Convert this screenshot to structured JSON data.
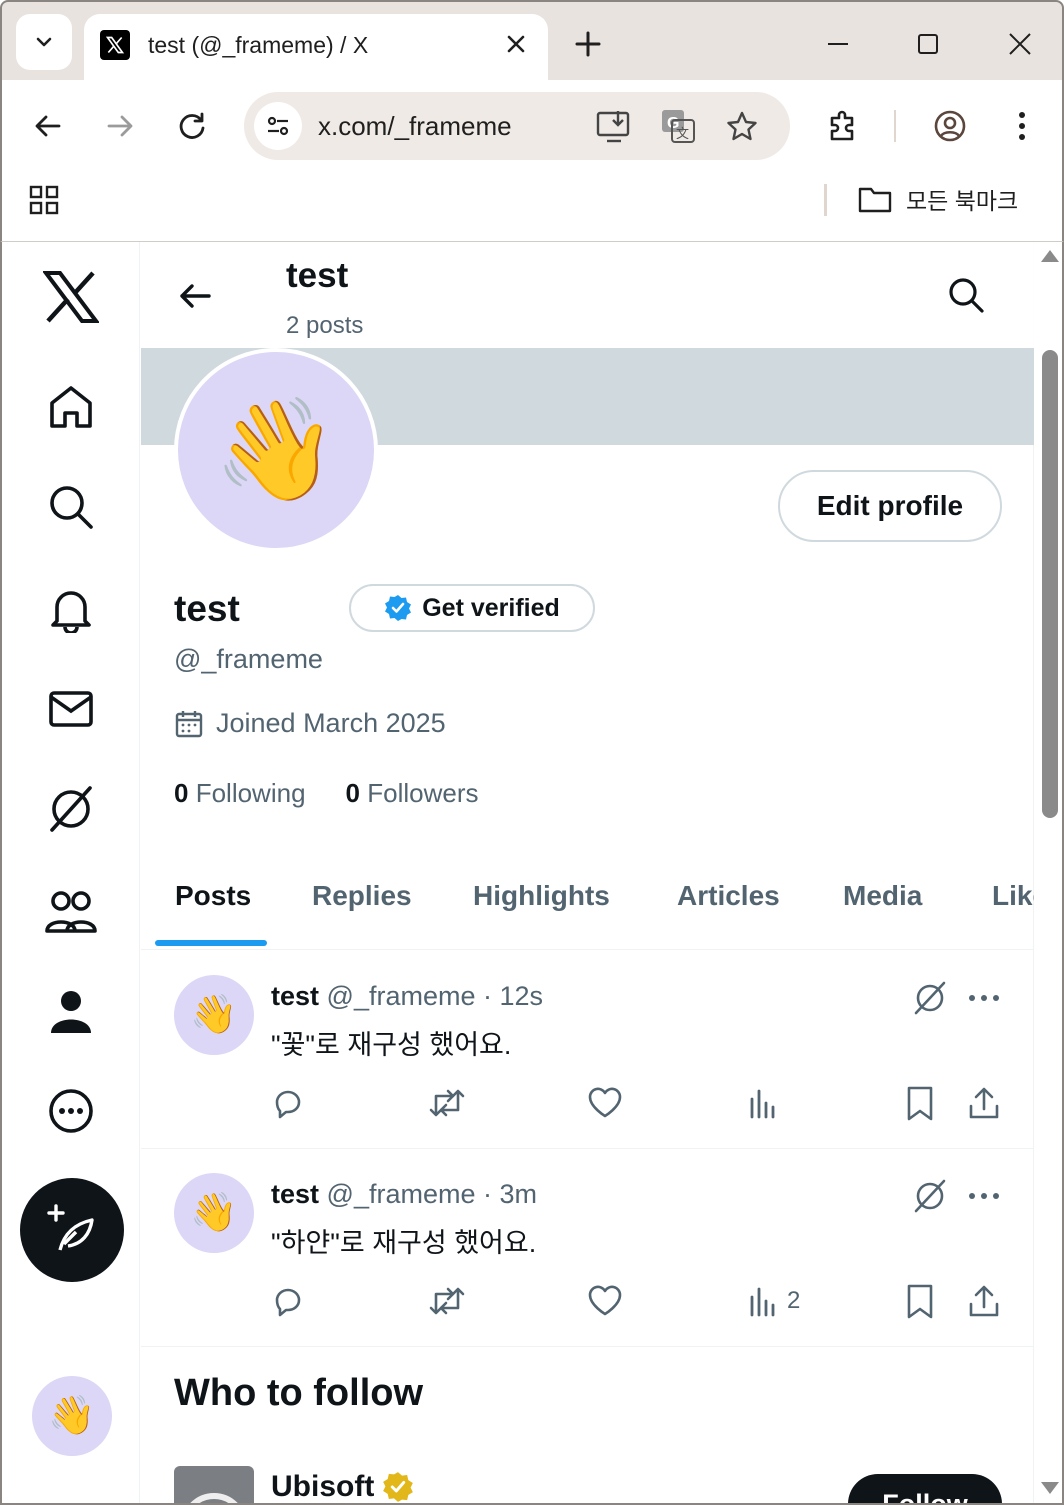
{
  "browser": {
    "tab_title": "test (@_frameme) / X",
    "url": "x.com/_frameme",
    "bookmarks_folder": "모든 북마크"
  },
  "header": {
    "name": "test",
    "post_count": "2 posts"
  },
  "profile": {
    "name": "test",
    "get_verified": "Get verified",
    "handle": "@_frameme",
    "joined": "Joined March 2025",
    "following_count": "0",
    "following_label": "Following",
    "followers_count": "0",
    "followers_label": "Followers",
    "edit_profile": "Edit profile",
    "avatar_emoji": "👋"
  },
  "tabs": [
    "Posts",
    "Replies",
    "Highlights",
    "Articles",
    "Media",
    "Likes"
  ],
  "posts": [
    {
      "name": "test",
      "handle": "@_frameme",
      "time": "· 12s",
      "text": "\"꽃\"로 재구성 했어요.",
      "views": ""
    },
    {
      "name": "test",
      "handle": "@_frameme",
      "time": "· 3m",
      "text": "\"하얀\"로 재구성 했어요.",
      "views": "2"
    }
  ],
  "who_to_follow": {
    "title": "Who to follow",
    "accounts": [
      {
        "name": "Ubisoft",
        "button": "Follow"
      }
    ]
  },
  "colors": {
    "accent": "#1d9bf0",
    "text": "#0f1419",
    "secondary": "#536471",
    "banner": "#cfd9de",
    "avatar_bg": "#dcd6f7",
    "gold_badge": "#e2b719"
  }
}
